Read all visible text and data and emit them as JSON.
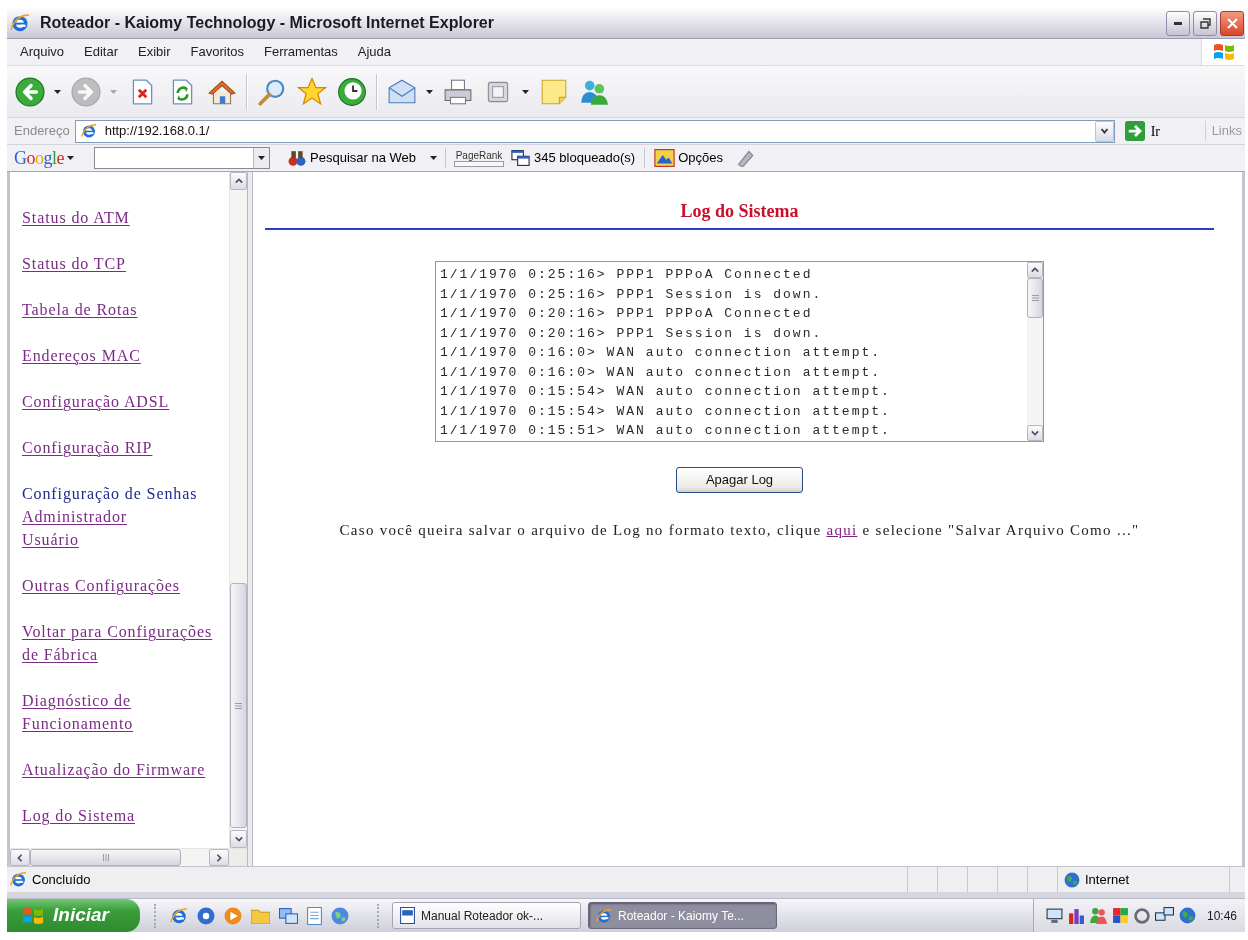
{
  "window": {
    "title": "Roteador - Kaiomy Technology - Microsoft Internet Explorer"
  },
  "menu": [
    "Arquivo",
    "Editar",
    "Exibir",
    "Favoritos",
    "Ferramentas",
    "Ajuda"
  ],
  "toolbar": [
    {
      "buttons": [
        {
          "kind": "back",
          "disabled": false
        },
        {
          "kind": "forward",
          "disabled": true
        },
        {
          "kind": "stop",
          "disabled": false
        },
        {
          "kind": "refresh",
          "disabled": false
        },
        {
          "kind": "home",
          "disabled": false
        }
      ]
    },
    {
      "buttons": [
        {
          "kind": "search",
          "disabled": false
        },
        {
          "kind": "favorites",
          "disabled": false
        },
        {
          "kind": "history",
          "disabled": false
        }
      ]
    },
    {
      "buttons": [
        {
          "kind": "mail",
          "disabled": false
        },
        {
          "kind": "print",
          "disabled": false
        },
        {
          "kind": "edit",
          "disabled": false
        },
        {
          "kind": "notes",
          "disabled": false
        },
        {
          "kind": "messenger",
          "disabled": false
        }
      ]
    }
  ],
  "address_bar": {
    "label": "Endereço",
    "value": "http://192.168.0.1/",
    "go": "Ir",
    "links": "Links"
  },
  "google_bar": {
    "logo": "Google",
    "search_button": "Pesquisar na Web",
    "pagerank": "PageRank",
    "blocked": "345 bloqueado(s)",
    "options": "Opções"
  },
  "sidebar": {
    "items": [
      {
        "kind": "link",
        "label": "Status do ATM"
      },
      {
        "kind": "link",
        "label": "Status do TCP"
      },
      {
        "kind": "link",
        "label": "Tabela de Rotas"
      },
      {
        "kind": "link",
        "label": "Endereços MAC"
      },
      {
        "kind": "link",
        "label": "Configuração ADSL"
      },
      {
        "kind": "link",
        "label": "Configuração RIP"
      },
      {
        "kind": "group",
        "label": "Configuração de Senhas",
        "children": [
          {
            "kind": "link",
            "label": "Administrador"
          },
          {
            "kind": "link",
            "label": "Usuário"
          }
        ]
      },
      {
        "kind": "link",
        "label": "Outras Configurações"
      },
      {
        "kind": "link",
        "label": "Voltar para Configurações de Fábrica"
      },
      {
        "kind": "link",
        "label": "Diagnóstico de Funcionamento"
      },
      {
        "kind": "link",
        "label": "Atualização do Firmware"
      },
      {
        "kind": "link",
        "label": "Log do Sistema"
      }
    ]
  },
  "page": {
    "title": "Log do Sistema",
    "log_lines": [
      "1/1/1970 0:25:16> PPP1 PPPoA Connected",
      "1/1/1970 0:25:16> PPP1 Session is down.",
      "1/1/1970 0:20:16> PPP1 PPPoA Connected",
      "1/1/1970 0:20:16> PPP1 Session is down.",
      "1/1/1970 0:16:0> WAN auto connection attempt.",
      "1/1/1970 0:16:0> WAN auto connection attempt.",
      "1/1/1970 0:15:54> WAN auto connection attempt.",
      "1/1/1970 0:15:54> WAN auto connection attempt.",
      "1/1/1970 0:15:51> WAN auto connection attempt."
    ],
    "clear_button": "Apagar Log",
    "hint": {
      "text_before": "Caso você queira salvar o arquivo de Log no formato texto, clique",
      "link": "aqui",
      "text_after": "e selecione \"Salvar Arquivo Como ...\""
    }
  },
  "status_bar": {
    "text": "Concluído",
    "zone": "Internet"
  },
  "taskbar": {
    "start": "Iniciar",
    "tasks": [
      {
        "kind": "document",
        "label": "Manual Roteador ok-...",
        "selected": false
      },
      {
        "kind": "browser",
        "label": "Roteador - Kaiomy Te...",
        "selected": true
      }
    ],
    "clock": "10:46"
  }
}
